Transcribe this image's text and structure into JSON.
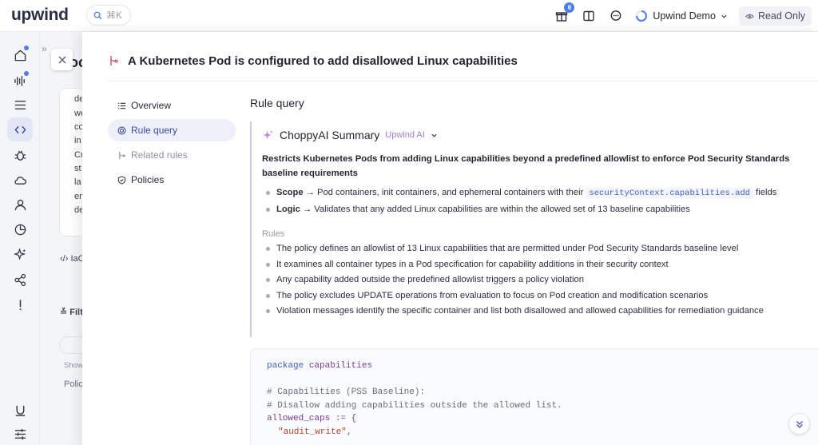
{
  "app": {
    "logo": "upwind"
  },
  "search": {
    "shortcut": "⌘K"
  },
  "topbar": {
    "gift_badge": "6",
    "org_name": "Upwind Demo",
    "read_only": "Read Only"
  },
  "background": {
    "lines": [
      "de",
      "we",
      "co",
      "in",
      "Cr",
      "st",
      "la",
      "en",
      "de"
    ],
    "iac_label": "IaC",
    "filter_label": "Filt",
    "show_label": "Show",
    "policy_label": "Polic",
    "partial_title": "oc"
  },
  "drawer": {
    "title": "A Kubernetes Pod is configured to add disallowed Linux capabilities"
  },
  "nav": [
    {
      "label": "Overview"
    },
    {
      "label": "Rule query"
    },
    {
      "label": "Related rules"
    },
    {
      "label": "Policies"
    }
  ],
  "content": {
    "section_title": "Rule query",
    "summary_title": "ChoppyAI Summary",
    "ai_tag": "Upwind AI",
    "description": "Restricts Kubernetes Pods from adding Linux capabilities beyond a predefined allowlist to enforce Pod Security Standards baseline requirements",
    "scope_label": "Scope",
    "scope_text": "→ Pod containers, init containers, and ephemeral containers with their",
    "scope_code": "securityContext.capabilities.add",
    "scope_suffix": "fields",
    "logic_label": "Logic",
    "logic_text": "→ Validates that any added Linux capabilities are within the allowed set of 13 baseline capabilities",
    "rules_label": "Rules",
    "rules": [
      "The policy defines an allowlist of 13 Linux capabilities that are permitted under Pod Security Standards baseline level",
      "It examines all container types in a Pod specification for capability additions in their security context",
      "Any capability added outside the predefined allowlist triggers a policy violation",
      "The policy excludes UPDATE operations from evaluation to focus on Pod creation and modification scenarios",
      "Violation messages identify the specific container and list both disallowed and allowed capabilities for remediation guidance"
    ]
  },
  "code": {
    "package_kw": "package",
    "package_name": "capabilities",
    "comment1": "# Capabilities (PSS Baseline):",
    "comment2": "# Disallow adding capabilities outside the allowed list.",
    "assign": "allowed_caps := {",
    "item1": "\"audit_write\","
  }
}
